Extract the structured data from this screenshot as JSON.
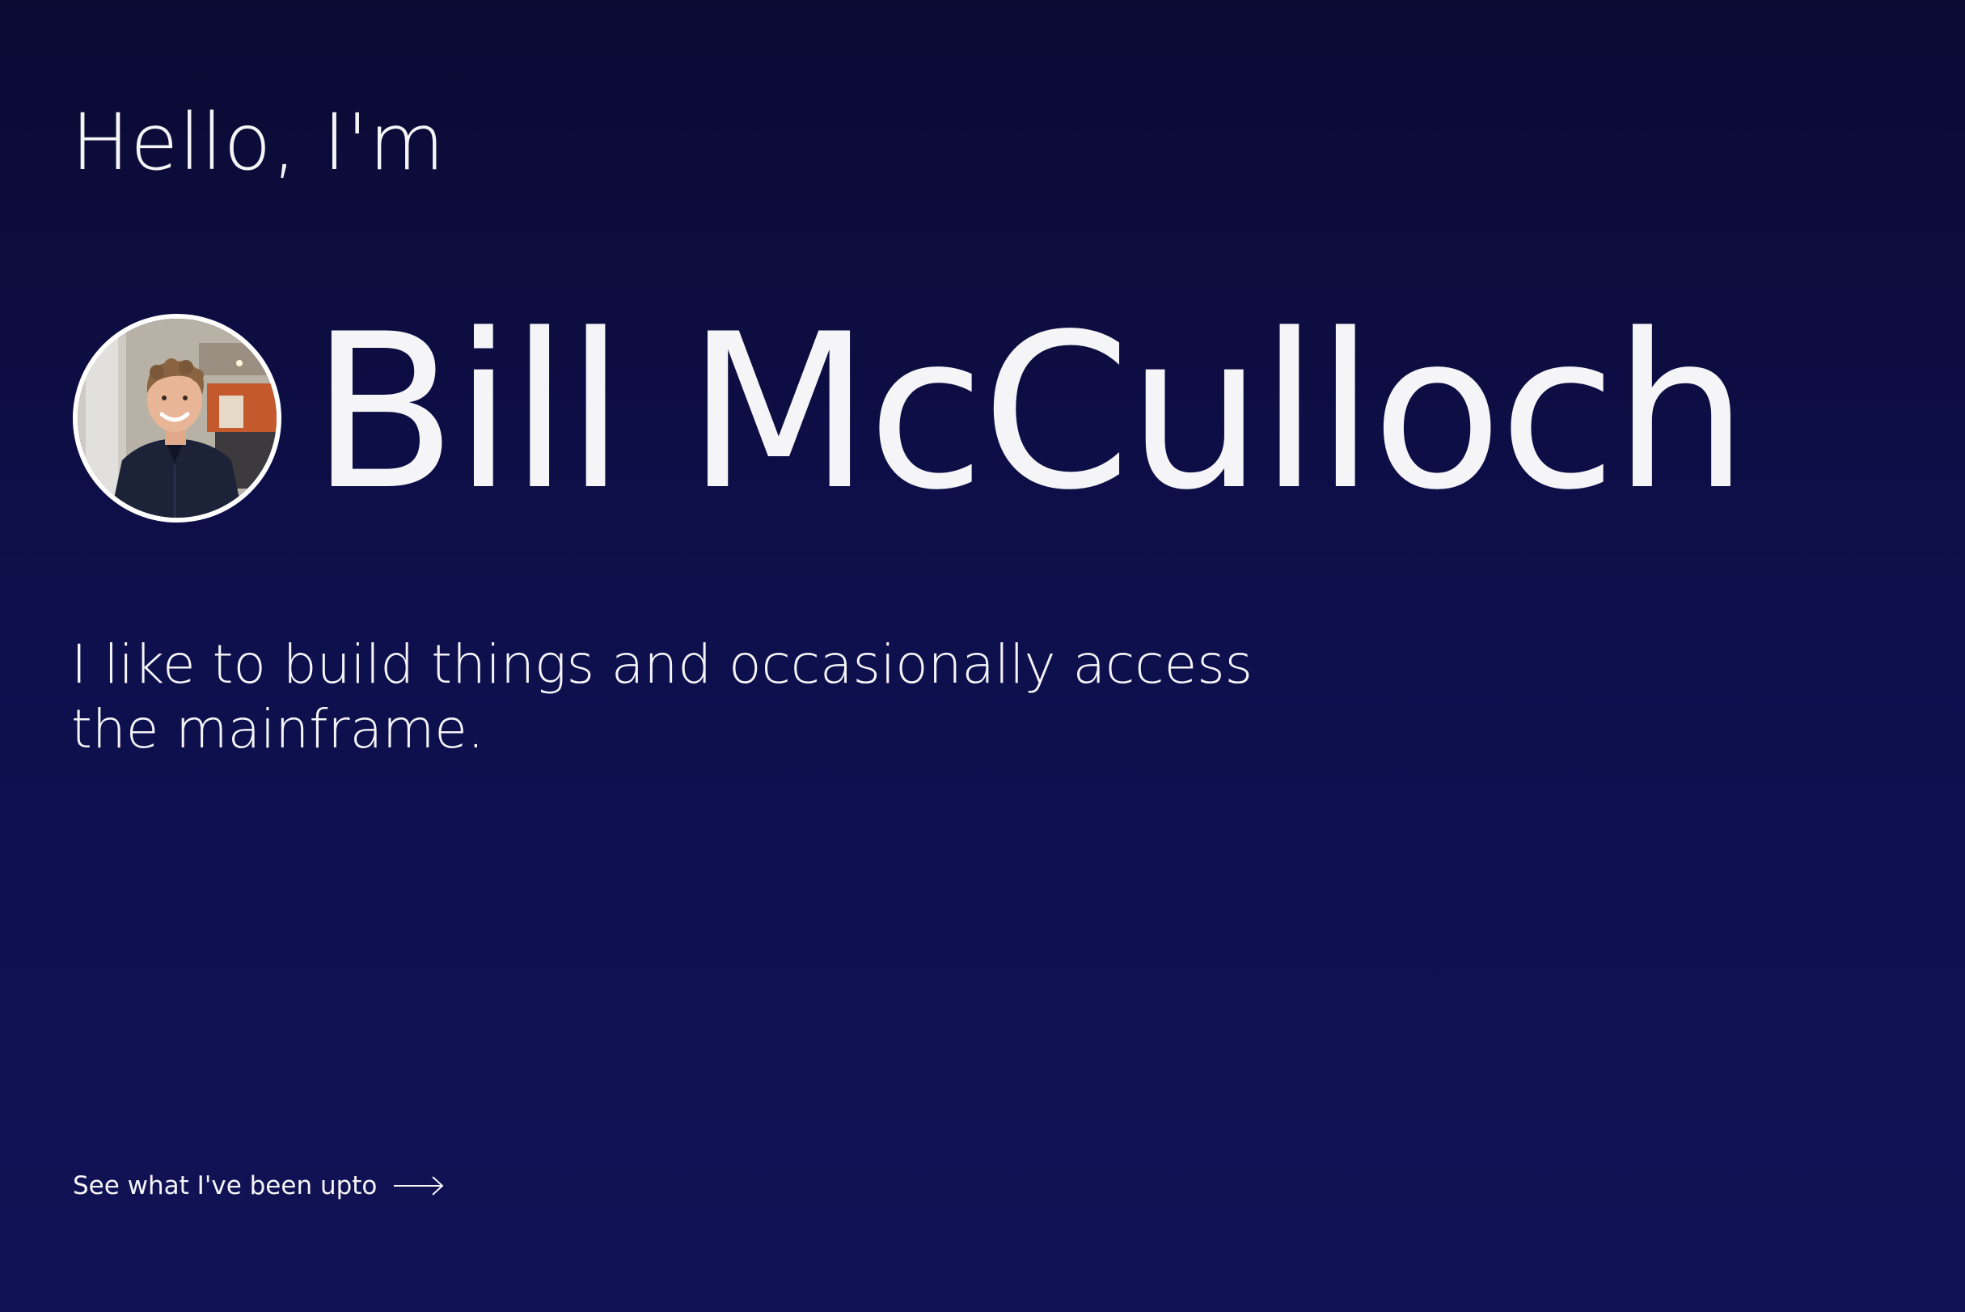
{
  "hero": {
    "greeting": "Hello, I'm",
    "name": "Bill McCulloch",
    "tagline": "I like to build things and occasionally access the mainframe.",
    "avatar_icon": "profile-photo",
    "cta_label": "See what I've been upto",
    "cta_icon": "arrow-right-icon"
  },
  "colors": {
    "background_top": "#0b0a33",
    "background_bottom": "#101256",
    "text": "#f5f5f8"
  }
}
